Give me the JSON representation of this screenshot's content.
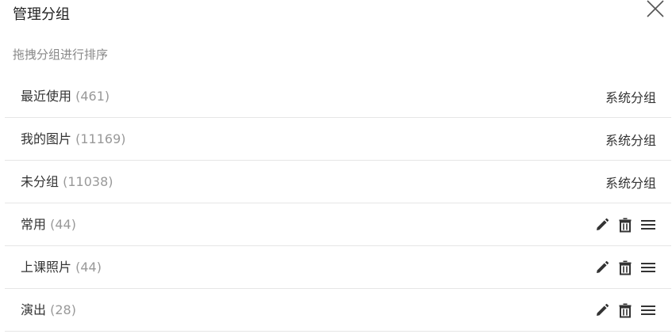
{
  "dialog": {
    "title": "管理分组",
    "hint": "拖拽分组进行排序"
  },
  "groups": [
    {
      "name": "最近使用",
      "count": "(461)",
      "type_label": "系统分组",
      "system": true
    },
    {
      "name": "我的图片",
      "count": "(11169)",
      "type_label": "系统分组",
      "system": true
    },
    {
      "name": "未分组",
      "count": "(11038)",
      "type_label": "系统分组",
      "system": true
    },
    {
      "name": "常用",
      "count": "(44)",
      "system": false
    },
    {
      "name": "上课照片",
      "count": "(44)",
      "system": false
    },
    {
      "name": "演出",
      "count": "(28)",
      "system": false
    }
  ],
  "icons": {
    "close": "close-icon",
    "edit": "pencil-icon",
    "delete": "trash-icon",
    "drag": "drag-handle-icon"
  },
  "colors": {
    "text": "#333333",
    "muted": "#999999",
    "divider": "#e6e6e6",
    "icon": "#333333"
  }
}
